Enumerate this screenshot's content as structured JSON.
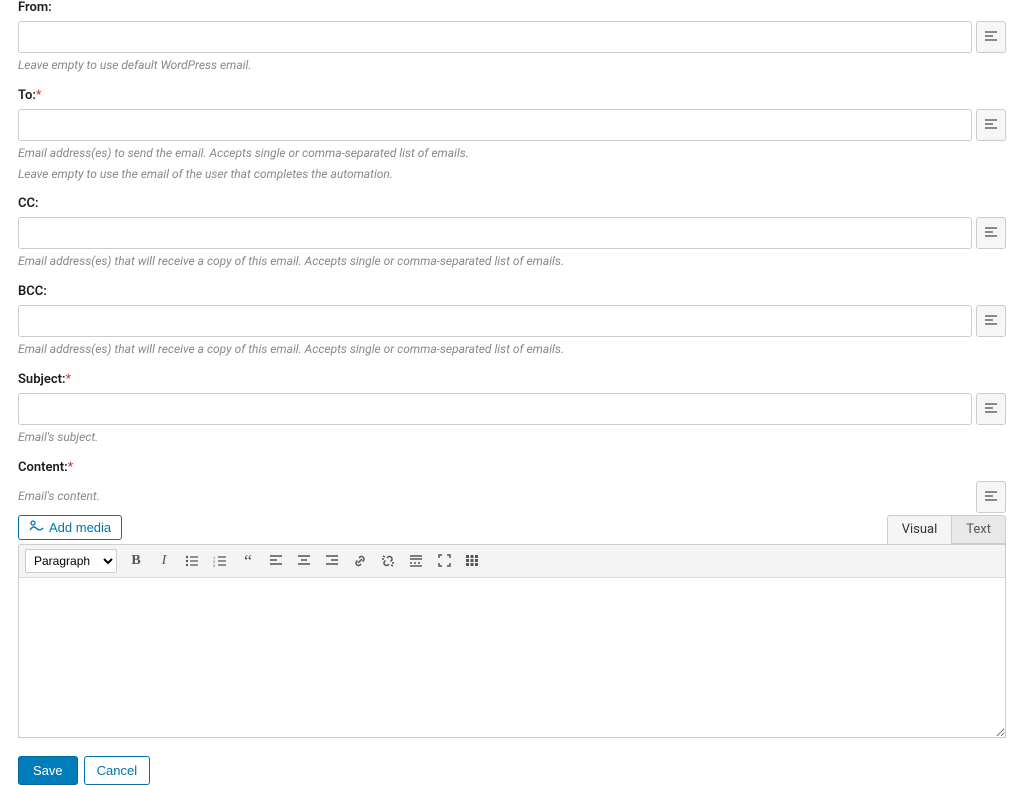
{
  "fields": {
    "from": {
      "label": "From:",
      "help": "Leave empty to use default WordPress email."
    },
    "to": {
      "label": "To:",
      "help1": "Email address(es) to send the email. Accepts single or comma-separated list of emails.",
      "help2": "Leave empty to use the email of the user that completes the automation."
    },
    "cc": {
      "label": "CC:",
      "help": "Email address(es) that will receive a copy of this email. Accepts single or comma-separated list of emails."
    },
    "bcc": {
      "label": "BCC:",
      "help": "Email address(es) that will receive a copy of this email. Accepts single or comma-separated list of emails."
    },
    "subject": {
      "label": "Subject:",
      "help": "Email's subject."
    },
    "content": {
      "label": "Content:",
      "help": "Email's content."
    }
  },
  "editor": {
    "addMedia": "Add media",
    "visualTab": "Visual",
    "textTab": "Text",
    "formatDefault": "Paragraph"
  },
  "actions": {
    "save": "Save",
    "cancel": "Cancel"
  }
}
